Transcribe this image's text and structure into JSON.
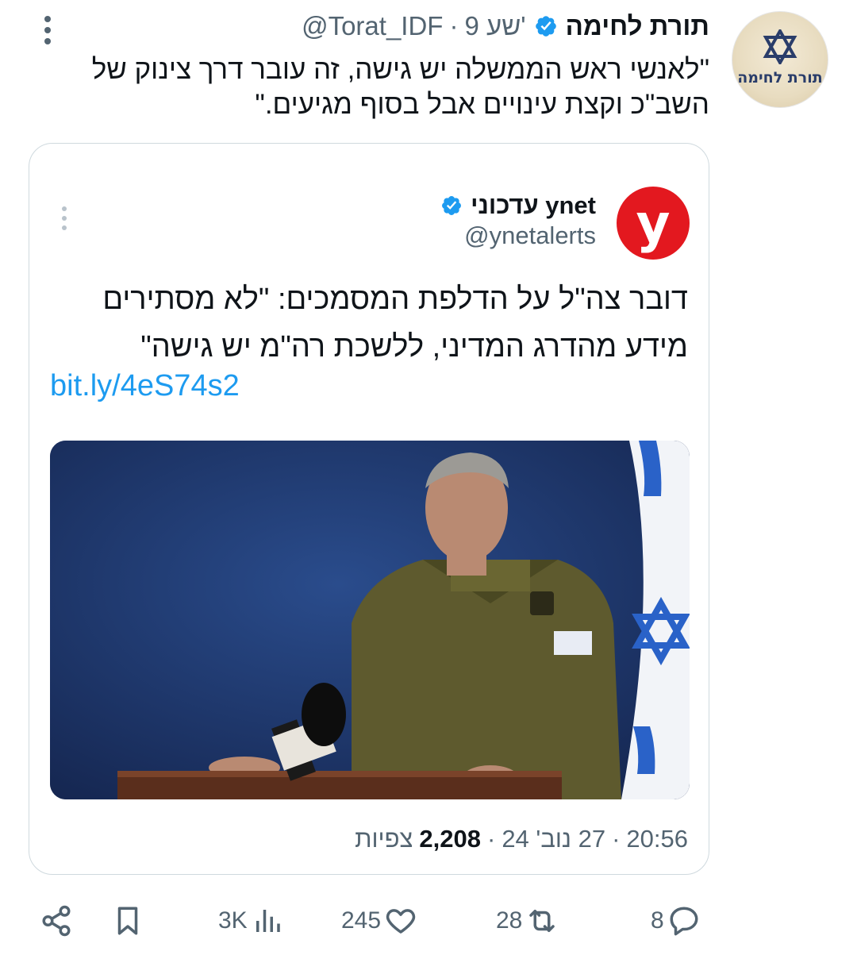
{
  "author": {
    "display_name": "תורת לחימה",
    "handle": "@Torat_IDF",
    "separator": "·",
    "time_ago": "9 שע'",
    "avatar_text": "תורת לחימה",
    "avatar_icon": "star-of-david-emblem"
  },
  "tweet": {
    "text": "\"לאנשי ראש הממשלה יש גישה, זה עובר דרך צינוק של השב\"כ וקצת עינויים אבל בסוף מגיעים.\""
  },
  "quote": {
    "display_name": "עדכוני ynet",
    "handle": "@ynetalerts",
    "avatar_letter": "y",
    "text": "דובר צה\"ל על הדלפת המסמכים: \"לא מסתירים מידע מהדרג המדיני, ללשכת רה\"מ יש גישה\"",
    "link": "bit.ly/4eS74s2",
    "media_icon": "photo-press-conference",
    "footer": {
      "time": "20:56",
      "date": "27 נוב' 24",
      "sep": "·",
      "views": "2,208",
      "views_label": "צפיות"
    }
  },
  "actions": {
    "replies": "8",
    "retweets": "28",
    "likes": "245",
    "views": "3K"
  },
  "colors": {
    "accent": "#1d9bf0",
    "muted": "#536471",
    "border": "#cfd9de",
    "ynet_red": "#e3181f"
  }
}
